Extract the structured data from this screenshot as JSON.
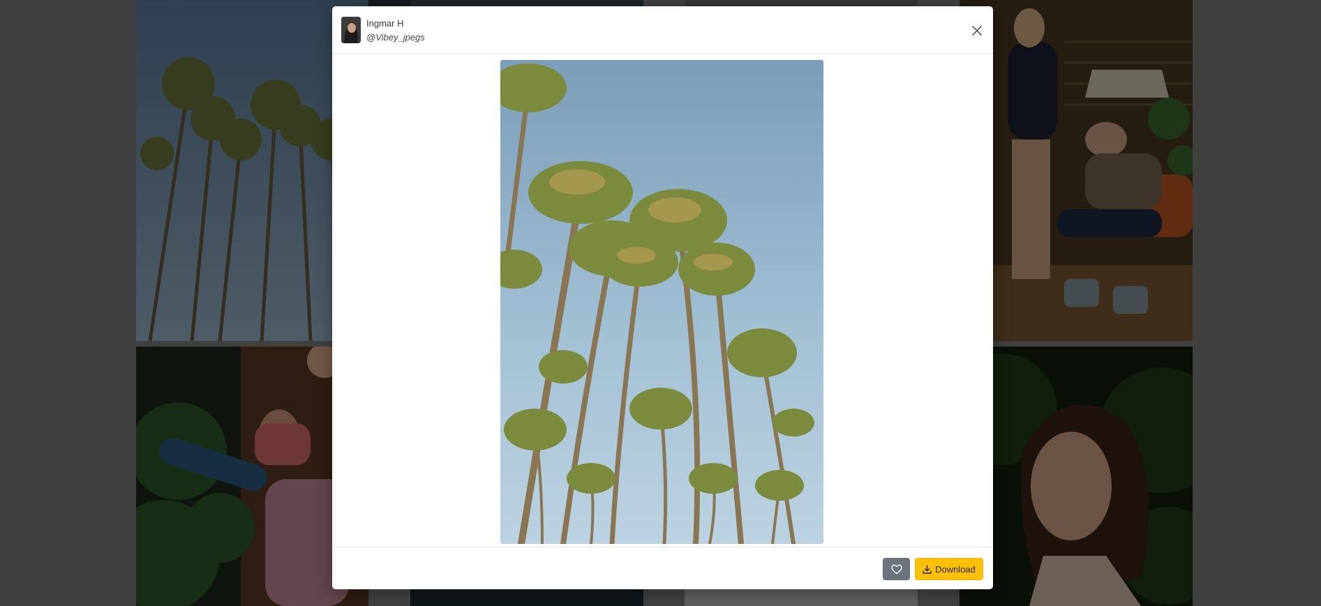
{
  "modal": {
    "user_name": "Ingmar H",
    "user_handle": "@Vibey_jpegs",
    "photo_subject": "palm trees against blue sky"
  },
  "footer": {
    "download_label": "Download"
  },
  "icons": {
    "close": "close-icon",
    "like": "heart-icon",
    "download": "download-icon"
  },
  "colors": {
    "download_button": "#ffc107",
    "like_button": "#6c757d",
    "overlay": "rgba(0,0,0,0.5)"
  }
}
